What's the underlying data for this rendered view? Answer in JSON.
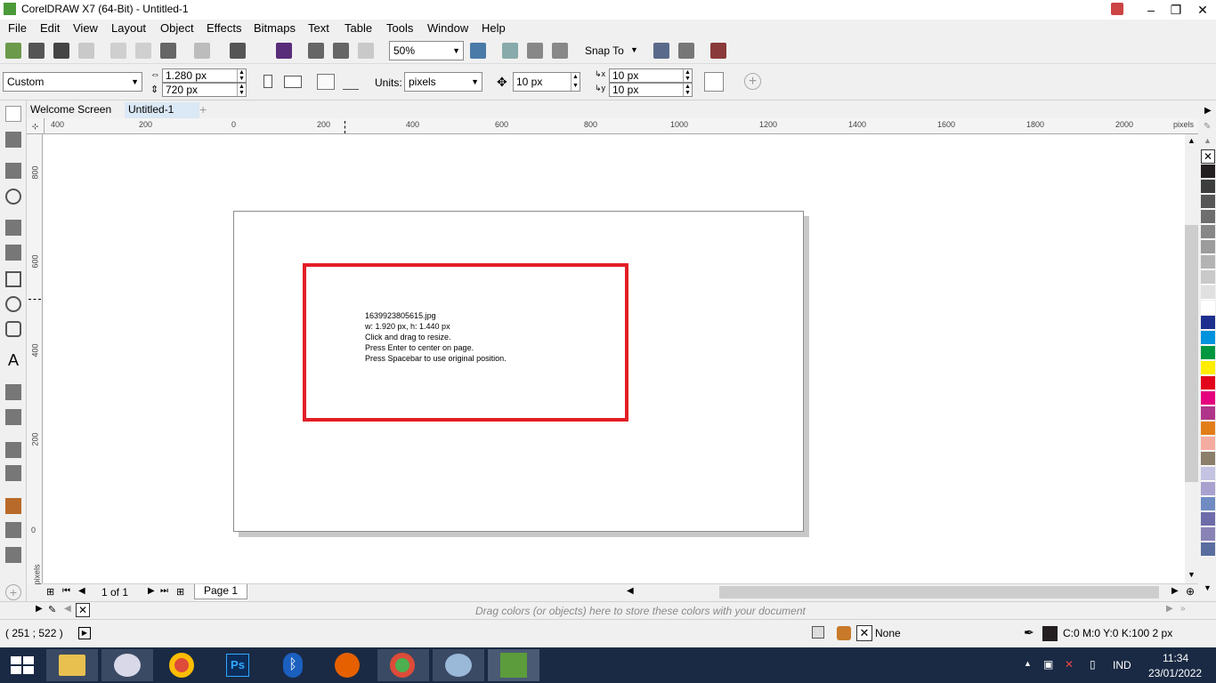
{
  "window": {
    "title": "CorelDRAW X7 (64-Bit) - Untitled-1",
    "min": "–",
    "max": "❐",
    "close": "✕"
  },
  "menu": [
    {
      "label": "File"
    },
    {
      "label": "Edit"
    },
    {
      "label": "View"
    },
    {
      "label": "Layout"
    },
    {
      "label": "Object"
    },
    {
      "label": "Effects"
    },
    {
      "label": "Bitmaps"
    },
    {
      "label": "Text"
    },
    {
      "label": "Table"
    },
    {
      "label": "Tools"
    },
    {
      "label": "Window"
    },
    {
      "label": "Help"
    }
  ],
  "toolbar": {
    "zoom": "50%",
    "snap_to": "Snap To"
  },
  "propbar": {
    "page_preset": "Custom",
    "width": "1.280 px",
    "height": "720 px",
    "units_label": "Units:",
    "units": "pixels",
    "nudge": "10 px",
    "dup_x": "10 px",
    "dup_y": "10 px"
  },
  "tabs": {
    "welcome": "Welcome Screen",
    "doc": "Untitled-1",
    "add": "+"
  },
  "ruler": {
    "units": "pixels",
    "h_labels": [
      "400",
      "200",
      "0",
      "200",
      "400",
      "600",
      "800",
      "1000",
      "1200",
      "1400",
      "1600",
      "1800",
      "2000"
    ],
    "v_labels": [
      "800",
      "600",
      "400",
      "200",
      "0"
    ],
    "v_units": "pixels"
  },
  "import_info": {
    "filename": "1639923805615.jpg",
    "dims": "w: 1.920 px, h: 1.440 px",
    "hint1": "Click and drag to resize.",
    "hint2": "Press Enter to center on page.",
    "hint3": "Press Spacebar to use original position."
  },
  "pagenav": {
    "count": "1 of 1",
    "page_tab": "Page 1"
  },
  "docpalette": {
    "hint": "Drag colors (or objects) here to store these colors with your document"
  },
  "status": {
    "coords": "( 251  ; 522  )",
    "fill": "None",
    "outline": "C:0 M:0 Y:0 K:100  2 px"
  },
  "palette_colors": [
    "#231f20",
    "#3d3d3d",
    "#575757",
    "#6e6e6e",
    "#878787",
    "#9c9c9c",
    "#b3b3b3",
    "#c9c9c9",
    "#e0e0e0",
    "#ffffff",
    "#1d2f8e",
    "#0093dd",
    "#00963f",
    "#ffed00",
    "#e3051b",
    "#e5007e",
    "#b0358a",
    "#e17e1a",
    "#f5aca0",
    "#8b7e6b",
    "#c4c3e2",
    "#a9a2cf",
    "#6f8bc2",
    "#6d6ba9",
    "#8a83b6",
    "#5b6d9e"
  ],
  "taskbar": {
    "lang": "IND",
    "time": "11:34",
    "date": "23/01/2022"
  }
}
